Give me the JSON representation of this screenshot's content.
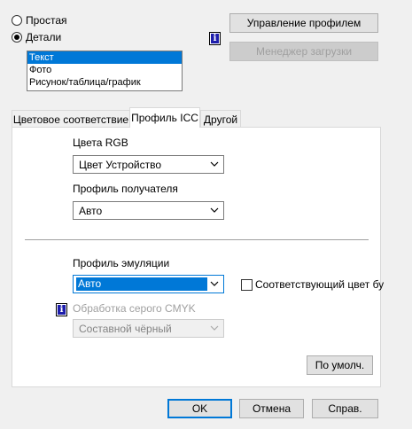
{
  "mode": {
    "simple_label": "Простая",
    "details_label": "Детали",
    "selected": "details"
  },
  "content_list": {
    "items": [
      "Текст",
      "Фото",
      "Рисунок/таблица/график"
    ],
    "selected_index": 0
  },
  "buttons": {
    "profile_management": "Управление профилем",
    "download_manager": "Менеджер загрузки",
    "defaults": "По умолч.",
    "ok": "OK",
    "cancel": "Отмена",
    "help": "Справ."
  },
  "tabs": {
    "color_matching": "Цветовое соответствие",
    "icc_profile": "Профиль ICC",
    "other": "Другой",
    "active": "icc_profile"
  },
  "icc": {
    "rgb_colors_label": "Цвета RGB",
    "rgb_colors_value": "Цвет Устройство",
    "destination_profile_label": "Профиль получателя",
    "destination_profile_value": "Авто",
    "emulation_profile_label": "Профиль эмуляции",
    "emulation_profile_value": "Авто",
    "matching_color_label": "Соответствующий цвет бу",
    "gray_cmyk_label": "Обработка серого CMYK",
    "gray_cmyk_value": "Составной чёрный"
  },
  "icons": {
    "info": "info-icon",
    "chevron": "chevron-down-icon"
  },
  "colors": {
    "accent": "#0078d7",
    "info_blue": "#1d1dab"
  }
}
